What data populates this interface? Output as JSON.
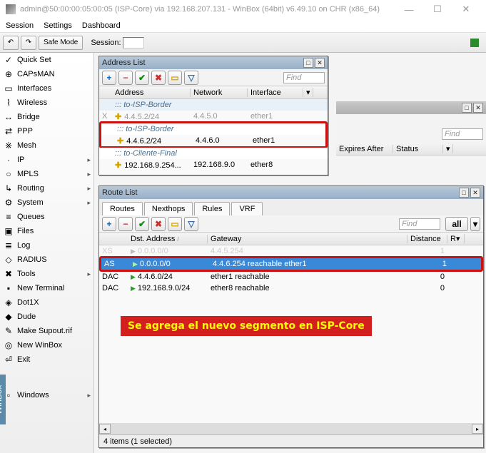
{
  "window": {
    "title": "admin@50:00:00:05:00:05 (ISP-Core) via 192.168.207.131 - WinBox (64bit) v6.49.10 on CHR (x86_64)"
  },
  "menubar": {
    "session": "Session",
    "settings": "Settings",
    "dashboard": "Dashboard"
  },
  "toolbar": {
    "safe_mode": "Safe Mode",
    "session_label": "Session:"
  },
  "sidebar": {
    "items": [
      {
        "label": "Quick Set",
        "icon": "✓",
        "arrow": false
      },
      {
        "label": "CAPsMAN",
        "icon": "⊕",
        "arrow": false
      },
      {
        "label": "Interfaces",
        "icon": "▭",
        "arrow": false
      },
      {
        "label": "Wireless",
        "icon": "⌇",
        "arrow": false
      },
      {
        "label": "Bridge",
        "icon": "↔",
        "arrow": false
      },
      {
        "label": "PPP",
        "icon": "⇄",
        "arrow": false
      },
      {
        "label": "Mesh",
        "icon": "※",
        "arrow": false
      },
      {
        "label": "IP",
        "icon": "·",
        "arrow": true
      },
      {
        "label": "MPLS",
        "icon": "○",
        "arrow": true
      },
      {
        "label": "Routing",
        "icon": "↳",
        "arrow": true
      },
      {
        "label": "System",
        "icon": "⚙",
        "arrow": true
      },
      {
        "label": "Queues",
        "icon": "≡",
        "arrow": false
      },
      {
        "label": "Files",
        "icon": "▣",
        "arrow": false
      },
      {
        "label": "Log",
        "icon": "≣",
        "arrow": false
      },
      {
        "label": "RADIUS",
        "icon": "◇",
        "arrow": false
      },
      {
        "label": "Tools",
        "icon": "✖",
        "arrow": true
      },
      {
        "label": "New Terminal",
        "icon": "▪",
        "arrow": false
      },
      {
        "label": "Dot1X",
        "icon": "◈",
        "arrow": false
      },
      {
        "label": "Dude",
        "icon": "◆",
        "arrow": false
      },
      {
        "label": "Make Supout.rif",
        "icon": "✎",
        "arrow": false
      },
      {
        "label": "New WinBox",
        "icon": "◎",
        "arrow": false
      },
      {
        "label": "Exit",
        "icon": "⏎",
        "arrow": false
      },
      {
        "label": "Windows",
        "icon": "▫",
        "arrow": true,
        "spacer_before": true
      }
    ],
    "winbox_tab": "WinBox"
  },
  "address_list": {
    "title": "Address List",
    "find": "Find",
    "cols": {
      "address": "Address",
      "network": "Network",
      "interface": "Interface"
    },
    "groups": {
      "g1": "::: to-ISP-Border",
      "g2": "::: to-ISP-Border",
      "g3": "::: to-Cliente-Final"
    },
    "rows": {
      "r1": {
        "flag": "X",
        "addr": "4.4.5.2/24",
        "net": "4.4.5.0",
        "iface": "ether1"
      },
      "r2": {
        "flag": "",
        "addr": "4.4.6.2/24",
        "net": "4.4.6.0",
        "iface": "ether1"
      },
      "r3": {
        "flag": "",
        "addr": "192.168.9.254...",
        "net": "192.168.9.0",
        "iface": "ether8"
      }
    }
  },
  "partial_win": {
    "find": "Find",
    "col1": "Expires After",
    "col2": "Status"
  },
  "route_list": {
    "title": "Route List",
    "tabs": {
      "routes": "Routes",
      "nexthops": "Nexthops",
      "rules": "Rules",
      "vrf": "VRF"
    },
    "find": "Find",
    "all": "all",
    "cols": {
      "dst": "Dst. Address",
      "gateway": "Gateway",
      "distance": "Distance",
      "r": "R"
    },
    "rows": {
      "r1": {
        "flag": "XS",
        "dst": "0.0.0.0/0",
        "gateway": "4.4.5.254",
        "dist": "1"
      },
      "r2": {
        "flag": "AS",
        "dst": "0.0.0.0/0",
        "gateway": "4.4.6.254 reachable ether1",
        "dist": "1"
      },
      "r3": {
        "flag": "DAC",
        "dst": "4.4.6.0/24",
        "gateway": "ether1 reachable",
        "dist": "0"
      },
      "r4": {
        "flag": "DAC",
        "dst": "192.168.9.0/24",
        "gateway": "ether8 reachable",
        "dist": "0"
      }
    },
    "status": "4 items (1 selected)"
  },
  "annotation": "Se agrega el nuevo segmento en ISP-Core"
}
